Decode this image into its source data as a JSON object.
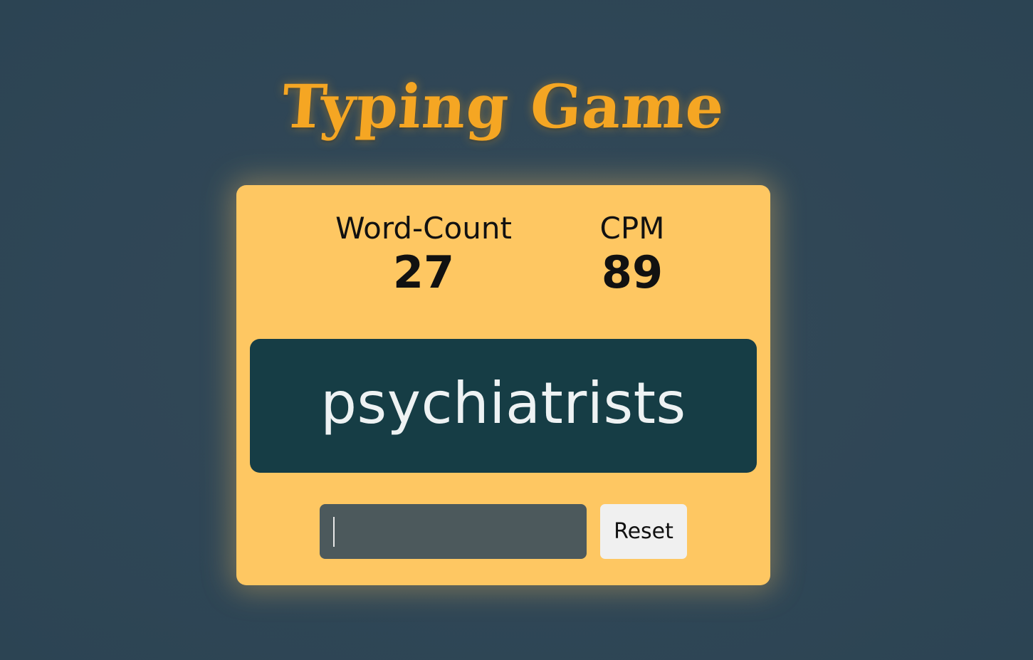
{
  "header": {
    "title": "Typing Game"
  },
  "stats": {
    "word_count_label": "Word-Count",
    "word_count_value": "27",
    "cpm_label": "CPM",
    "cpm_value": "89"
  },
  "current_word": "psychiatrists",
  "input": {
    "value": "",
    "placeholder": ""
  },
  "controls": {
    "reset_label": "Reset"
  },
  "colors": {
    "background": "#2f4656",
    "title": "#f5a623",
    "card": "#fec762",
    "word_box": "#163d45",
    "word_text": "#eef2f3",
    "input_bg": "#4c595c",
    "button_bg": "#f0f0f0"
  }
}
